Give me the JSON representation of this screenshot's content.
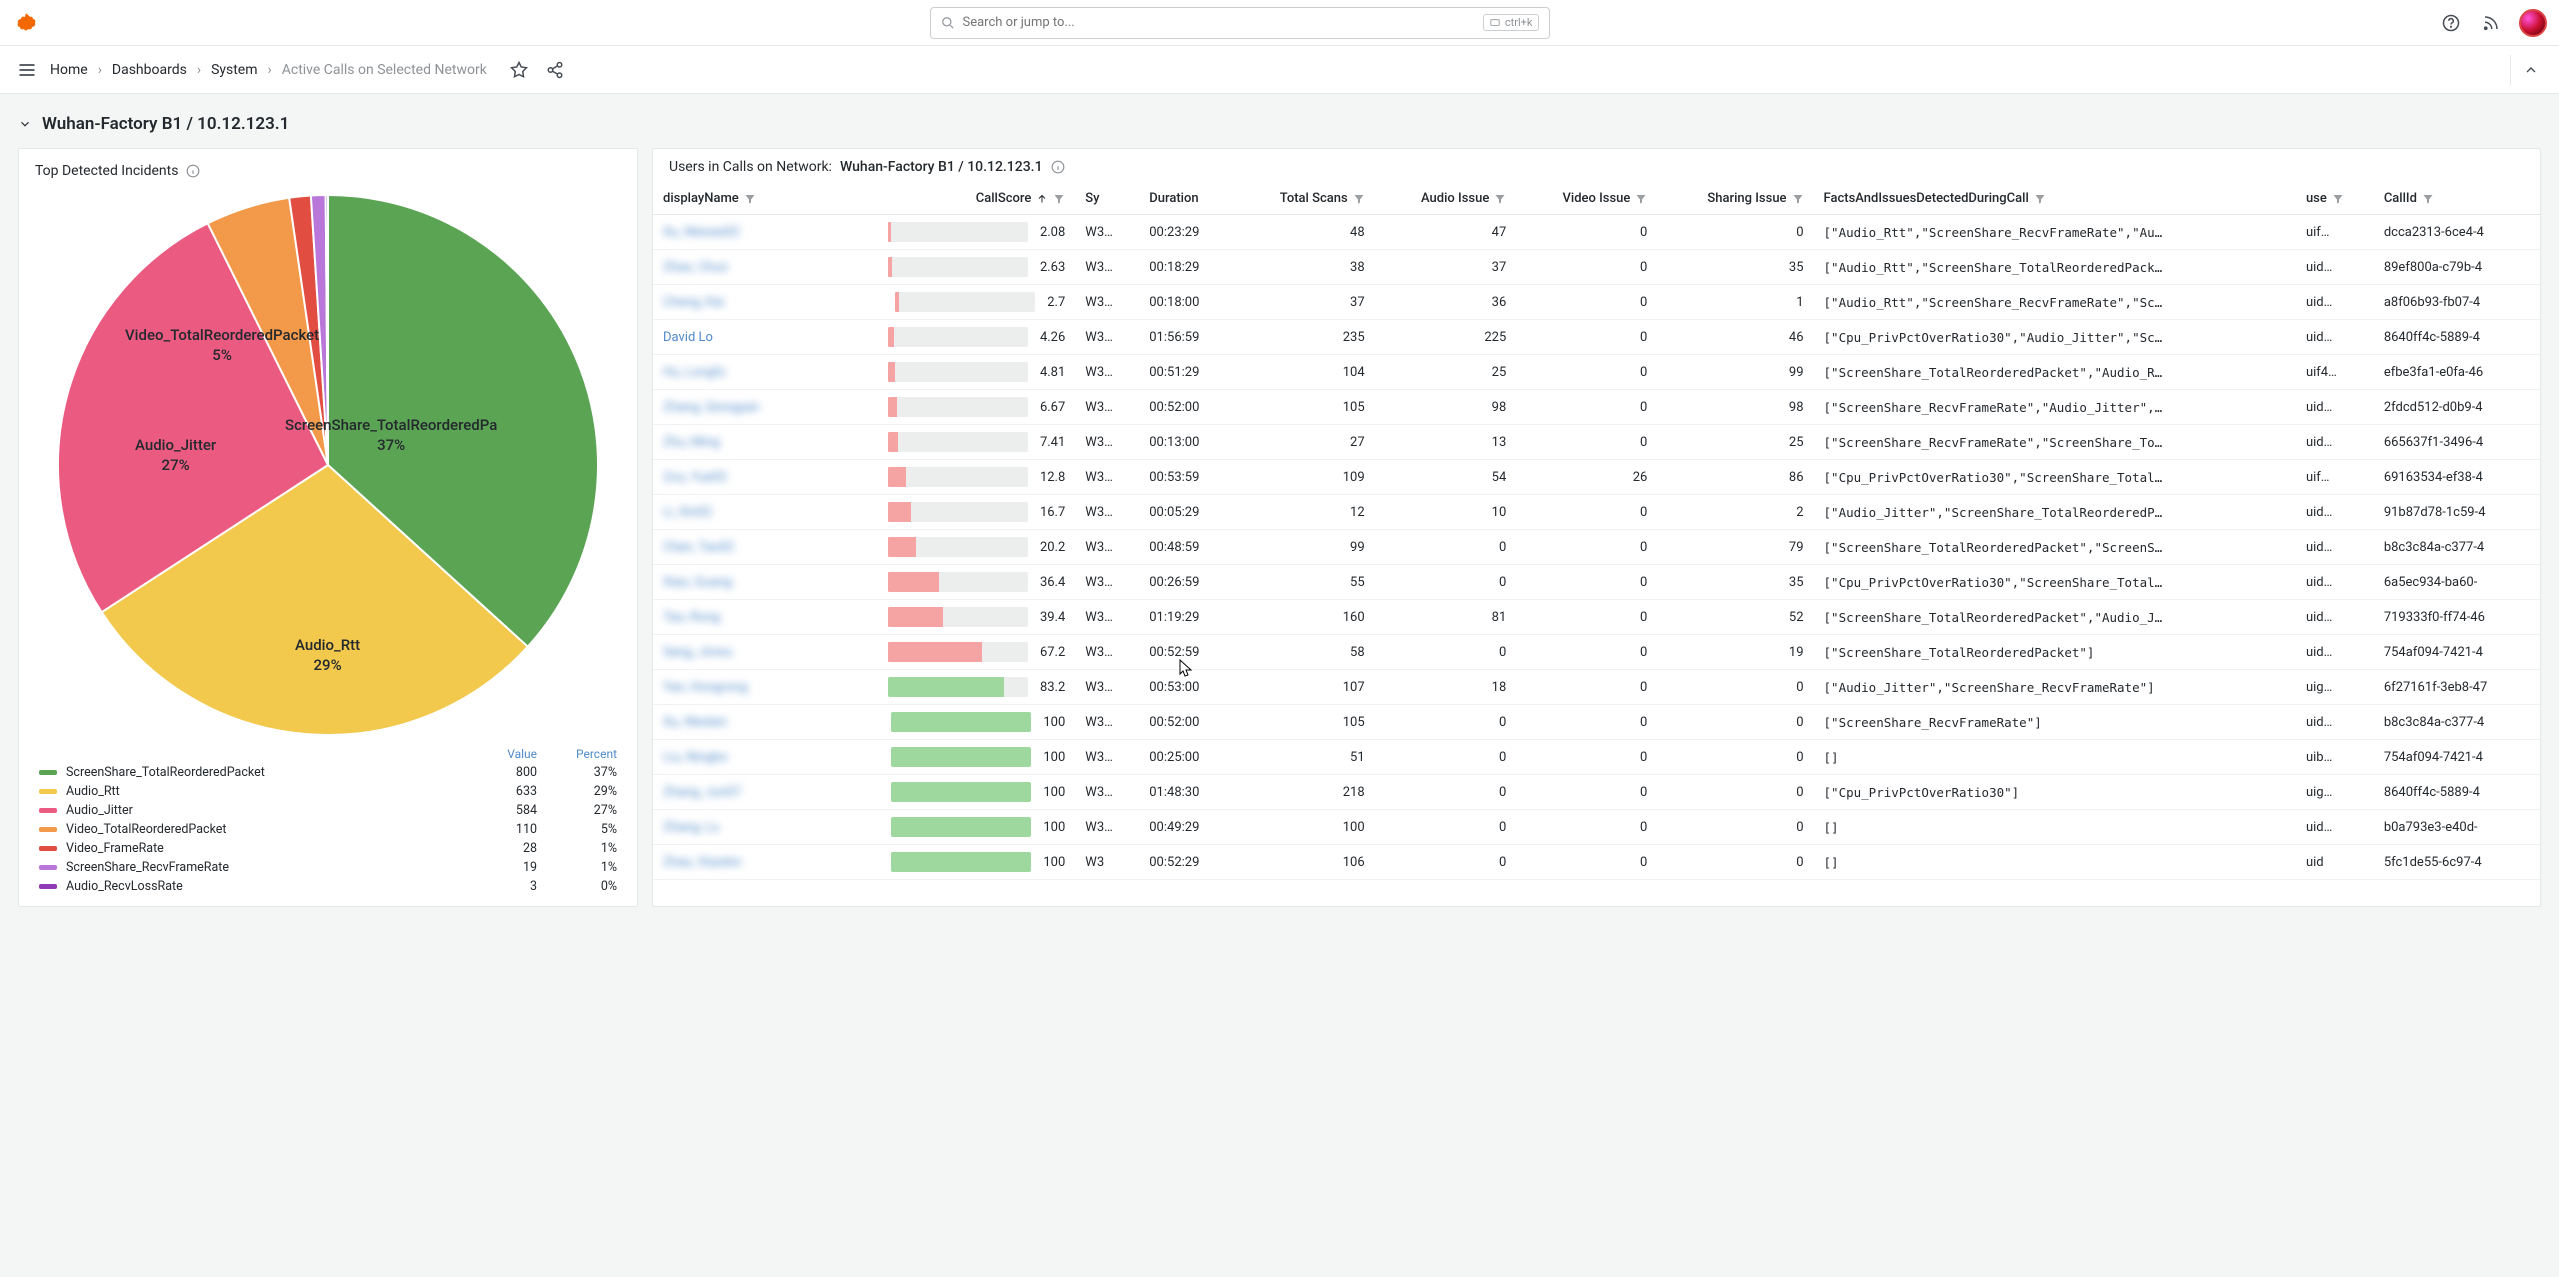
{
  "search": {
    "placeholder": "Search or jump to...",
    "kbd": "ctrl+k"
  },
  "breadcrumbs": {
    "items": [
      "Home",
      "Dashboards",
      "System",
      "Active Calls on Selected Network"
    ]
  },
  "row": {
    "title": "Wuhan-Factory B1 / 10.12.123.1"
  },
  "left_panel": {
    "title": "Top Detected Incidents",
    "legend_headers": {
      "value": "Value",
      "percent": "Percent"
    },
    "legend": [
      {
        "color": "#5aa454",
        "name": "ScreenShare_TotalReorderedPacket",
        "value": "800",
        "pct": "37%"
      },
      {
        "color": "#f2c94c",
        "name": "Audio_Rtt",
        "value": "633",
        "pct": "29%"
      },
      {
        "color": "#eb5b81",
        "name": "Audio_Jitter",
        "value": "584",
        "pct": "27%"
      },
      {
        "color": "#f2994a",
        "name": "Video_TotalReorderedPacket",
        "value": "110",
        "pct": "5%"
      },
      {
        "color": "#e24d42",
        "name": "Video_FrameRate",
        "value": "28",
        "pct": "1%"
      },
      {
        "color": "#b877d9",
        "name": "ScreenShare_RecvFrameRate",
        "value": "19",
        "pct": "1%"
      },
      {
        "color": "#8f3bb8",
        "name": "Audio_RecvLossRate",
        "value": "3",
        "pct": "0%"
      }
    ],
    "pie_labels": {
      "ss": "ScreenShare_TotalReorderedPa\n37%",
      "rtt": "Audio_Rtt\n29%",
      "jit": "Audio_Jitter\n27%",
      "vid": "Video_TotalReorderedPacket\n5%"
    }
  },
  "right_panel": {
    "title_prefix": "Users in Calls on Network:",
    "title_value": "Wuhan-Factory B1 / 10.12.123.1",
    "columns": {
      "displayName": "displayName",
      "callScore": "CallScore",
      "sy": "Sy",
      "duration": "Duration",
      "totalScans": "Total Scans",
      "audio": "Audio Issue",
      "video": "Video Issue",
      "sharing": "Sharing Issue",
      "facts": "FactsAndIssuesDetectedDuringCall",
      "use": "use",
      "callId": "CallId"
    },
    "rows": [
      {
        "name": "Xu, Weiwei02",
        "blur": true,
        "score": 2.08,
        "sy": "W3…",
        "dur": "00:23:29",
        "scans": 48,
        "audio": 47,
        "video": 0,
        "sharing": 0,
        "facts": "[\"Audio_Rtt\",\"ScreenShare_RecvFrameRate\",\"Au…",
        "use": "uif…",
        "callId": "dcca2313-6ce4-4"
      },
      {
        "name": "Zhao, Chun",
        "blur": true,
        "score": 2.63,
        "sy": "W3…",
        "dur": "00:18:29",
        "scans": 38,
        "audio": 37,
        "video": 0,
        "sharing": 35,
        "facts": "[\"Audio_Rtt\",\"ScreenShare_TotalReorderedPack…",
        "use": "uid…",
        "callId": "89ef800a-c79b-4"
      },
      {
        "name": "Cheng, Kai",
        "blur": true,
        "score": 2.7,
        "sy": "W3…",
        "dur": "00:18:00",
        "scans": 37,
        "audio": 36,
        "video": 0,
        "sharing": 1,
        "facts": "[\"Audio_Rtt\",\"ScreenShare_RecvFrameRate\",\"Sc…",
        "use": "uid…",
        "callId": "a8f06b93-fb07-4"
      },
      {
        "name": "David Lo",
        "blur": false,
        "score": 4.26,
        "sy": "W3…",
        "dur": "01:56:59",
        "scans": 235,
        "audio": 225,
        "video": 0,
        "sharing": 46,
        "facts": "[\"Cpu_PrivPctOverRatio30\",\"Audio_Jitter\",\"Sc…",
        "use": "uid…",
        "callId": "8640ff4c-5889-4"
      },
      {
        "name": "Hu, Longfu",
        "blur": true,
        "score": 4.81,
        "sy": "W3…",
        "dur": "00:51:29",
        "scans": 104,
        "audio": 25,
        "video": 0,
        "sharing": 99,
        "facts": "[\"ScreenShare_TotalReorderedPacket\",\"Audio_R…",
        "use": "uif4…",
        "callId": "efbe3fa1-e0fa-46"
      },
      {
        "name": "Zhang, Qiongyan",
        "blur": true,
        "score": 6.67,
        "sy": "W3…",
        "dur": "00:52:00",
        "scans": 105,
        "audio": 98,
        "video": 0,
        "sharing": 98,
        "facts": "[\"ScreenShare_RecvFrameRate\",\"Audio_Jitter\",…",
        "use": "uid…",
        "callId": "2fdcd512-d0b9-4"
      },
      {
        "name": "Zhu, Ming",
        "blur": true,
        "score": 7.41,
        "sy": "W3…",
        "dur": "00:13:00",
        "scans": 27,
        "audio": 13,
        "video": 0,
        "sharing": 25,
        "facts": "[\"ScreenShare_RecvFrameRate\",\"ScreenShare_To…",
        "use": "uid…",
        "callId": "665637f1-3496-4"
      },
      {
        "name": "Zou, Yue02",
        "blur": true,
        "score": 12.8,
        "sy": "W3…",
        "dur": "00:53:59",
        "scans": 109,
        "audio": 54,
        "video": 26,
        "sharing": 86,
        "facts": "[\"Cpu_PrivPctOverRatio30\",\"ScreenShare_Total…",
        "use": "uif…",
        "callId": "69163534-ef38-4"
      },
      {
        "name": "Li, Xin02",
        "blur": true,
        "score": 16.7,
        "sy": "W3…",
        "dur": "00:05:29",
        "scans": 12,
        "audio": 10,
        "video": 0,
        "sharing": 2,
        "facts": "[\"Audio_Jitter\",\"ScreenShare_TotalReorderedP…",
        "use": "uid…",
        "callId": "91b87d78-1c59-4"
      },
      {
        "name": "Chen, Tao02",
        "blur": true,
        "score": 20.2,
        "sy": "W3…",
        "dur": "00:48:59",
        "scans": 99,
        "audio": 0,
        "video": 0,
        "sharing": 79,
        "facts": "[\"ScreenShare_TotalReorderedPacket\",\"ScreenS…",
        "use": "uid…",
        "callId": "b8c3c84a-c377-4"
      },
      {
        "name": "Xiao, Guang",
        "blur": true,
        "score": 36.4,
        "sy": "W3…",
        "dur": "00:26:59",
        "scans": 55,
        "audio": 0,
        "video": 0,
        "sharing": 35,
        "facts": "[\"Cpu_PrivPctOverRatio30\",\"ScreenShare_Total…",
        "use": "uid…",
        "callId": "6a5ec934-ba60-"
      },
      {
        "name": "Tao, Rong",
        "blur": true,
        "score": 39.4,
        "sy": "W3…",
        "dur": "01:19:29",
        "scans": 160,
        "audio": 81,
        "video": 0,
        "sharing": 52,
        "facts": "[\"ScreenShare_TotalReorderedPacket\",\"Audio_J…",
        "use": "uid…",
        "callId": "719333f0-ff74-46"
      },
      {
        "name": "Sang, Jinwu",
        "blur": true,
        "score": 67.2,
        "sy": "W3…",
        "dur": "00:52:59",
        "scans": 58,
        "audio": 0,
        "video": 0,
        "sharing": 19,
        "facts": "[\"ScreenShare_TotalReorderedPacket\"]",
        "use": "uid…",
        "callId": "754af094-7421-4"
      },
      {
        "name": "Yan, Hongrong",
        "blur": true,
        "score": 83.2,
        "sy": "W3…",
        "dur": "00:53:00",
        "scans": 107,
        "audio": 18,
        "video": 0,
        "sharing": 0,
        "facts": "[\"Audio_Jitter\",\"ScreenShare_RecvFrameRate\"]",
        "use": "uig…",
        "callId": "6f27161f-3eb8-47"
      },
      {
        "name": "Xu, Wenbin",
        "blur": true,
        "score": 100,
        "sy": "W3…",
        "dur": "00:52:00",
        "scans": 105,
        "audio": 0,
        "video": 0,
        "sharing": 0,
        "facts": "[\"ScreenShare_RecvFrameRate\"]",
        "use": "uid…",
        "callId": "b8c3c84a-c377-4"
      },
      {
        "name": "Liu, Ningbo",
        "blur": true,
        "score": 100,
        "sy": "W3…",
        "dur": "00:25:00",
        "scans": 51,
        "audio": 0,
        "video": 0,
        "sharing": 0,
        "facts": "[]",
        "use": "uib…",
        "callId": "754af094-7421-4"
      },
      {
        "name": "Zhang, Jun07",
        "blur": true,
        "score": 100,
        "sy": "W3…",
        "dur": "01:48:30",
        "scans": 218,
        "audio": 0,
        "video": 0,
        "sharing": 0,
        "facts": "[\"Cpu_PrivPctOverRatio30\"]",
        "use": "uig…",
        "callId": "8640ff4c-5889-4"
      },
      {
        "name": "Zhang, Lu",
        "blur": true,
        "score": 100,
        "sy": "W3…",
        "dur": "00:49:29",
        "scans": 100,
        "audio": 0,
        "video": 0,
        "sharing": 0,
        "facts": "[]",
        "use": "uid…",
        "callId": "b0a793e3-e40d-"
      },
      {
        "name": "Zhao, Xiaobin",
        "blur": true,
        "score": 100,
        "sy": "W3",
        "dur": "00:52:29",
        "scans": 106,
        "audio": 0,
        "video": 0,
        "sharing": 0,
        "facts": "[]",
        "use": "uid",
        "callId": "5fc1de55-6c97-4"
      }
    ]
  },
  "chart_data": {
    "type": "pie",
    "title": "Top Detected Incidents",
    "series": [
      {
        "name": "ScreenShare_TotalReorderedPacket",
        "value": 800,
        "pct": 37,
        "color": "#5aa454"
      },
      {
        "name": "Audio_Rtt",
        "value": 633,
        "pct": 29,
        "color": "#f2c94c"
      },
      {
        "name": "Audio_Jitter",
        "value": 584,
        "pct": 27,
        "color": "#eb5b81"
      },
      {
        "name": "Video_TotalReorderedPacket",
        "value": 110,
        "pct": 5,
        "color": "#f2994a"
      },
      {
        "name": "Video_FrameRate",
        "value": 28,
        "pct": 1,
        "color": "#e24d42"
      },
      {
        "name": "ScreenShare_RecvFrameRate",
        "value": 19,
        "pct": 1,
        "color": "#b877d9"
      },
      {
        "name": "Audio_RecvLossRate",
        "value": 3,
        "pct": 0,
        "color": "#8f3bb8"
      }
    ]
  }
}
